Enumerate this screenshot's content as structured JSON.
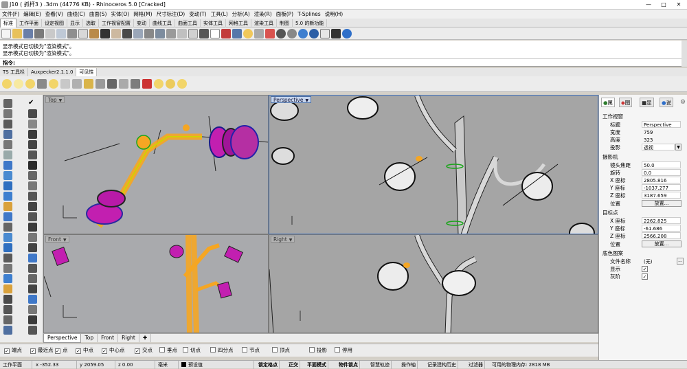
{
  "window": {
    "title": "J10 ( 抓杆3 ) .3dm (44776 KB) - Rhinoceros 5.0 [Cracked]",
    "minimize": "—",
    "maximize": "□",
    "close": "✕"
  },
  "menu": [
    "文件(F)",
    "编辑(E)",
    "查看(V)",
    "曲线(C)",
    "曲面(S)",
    "实体(O)",
    "网格(M)",
    "尺寸标注(D)",
    "变动(T)",
    "工具(L)",
    "分析(A)",
    "渲染(R)",
    "面板(P)",
    "T-Splines",
    "说明(H)"
  ],
  "toolbar_tabs": {
    "items": [
      "标准",
      "工作平面",
      "设定视图",
      "显示",
      "选取",
      "工作视窗配置",
      "变动",
      "曲线工具",
      "曲面工具",
      "实体工具",
      "网格工具",
      "渲染工具",
      "制图",
      "5.0 的新功能"
    ],
    "active": 0
  },
  "command": {
    "history": [
      "显示模式已切换为\"渲染模式\"。",
      "显示模式已切换为\"渲染模式\"。"
    ],
    "prompt": "指令:"
  },
  "toolbar2_tabs": {
    "items": [
      "TS 工具栏",
      "Auxpecker2.1.1.0",
      "可见性"
    ],
    "active": 2
  },
  "viewports": [
    {
      "label": "Top",
      "active": false
    },
    {
      "label": "Perspective",
      "active": true
    },
    {
      "label": "Front",
      "active": false
    },
    {
      "label": "Right",
      "active": false
    }
  ],
  "viewport_tabs": {
    "items": [
      "Perspective",
      "Top",
      "Front",
      "Right"
    ],
    "active": 0,
    "add": "✚"
  },
  "osnaps": [
    {
      "label": "端点",
      "checked": true
    },
    {
      "label": "最近点",
      "checked": true
    },
    {
      "label": "点",
      "checked": true
    },
    {
      "label": "中点",
      "checked": true
    },
    {
      "label": "中心点",
      "checked": true
    },
    {
      "label": "交点",
      "checked": true
    },
    {
      "label": "垂点",
      "checked": false
    },
    {
      "label": "切点",
      "checked": false
    },
    {
      "label": "四分点",
      "checked": false
    },
    {
      "label": "节点",
      "checked": false
    },
    {
      "label": "顶点",
      "checked": false
    },
    {
      "label": "投影",
      "checked": false
    },
    {
      "label": "停用",
      "checked": false
    }
  ],
  "status": {
    "cplane": "工作平面",
    "x": "x -352.33",
    "y": "y 2059.05",
    "z": "z 0.00",
    "unit": "毫米",
    "layer": "预设值",
    "items": [
      "锁定格点",
      "正交",
      "平面模式",
      "物件锁点",
      "智慧轨迹",
      "操作轴",
      "记录建构历史",
      "过滤器"
    ],
    "memory": "可用的物理内存: 2818 MB"
  },
  "panel": {
    "tabs": [
      "属",
      "图",
      "显",
      "说"
    ],
    "active_tab": 0,
    "section_viewport": "工作视窗",
    "vp_rows": [
      {
        "label": "标题",
        "value": "Perspective"
      },
      {
        "label": "宽度",
        "value": "759"
      },
      {
        "label": "高度",
        "value": "323"
      },
      {
        "label": "投影",
        "value": "透视"
      }
    ],
    "section_camera": "摄影机",
    "cam_rows": [
      {
        "label": "镜头焦距",
        "value": "50.0"
      },
      {
        "label": "旋转",
        "value": "0.0"
      },
      {
        "label": "X 座标",
        "value": "2805.816"
      },
      {
        "label": "Y 座标",
        "value": "-1037.277"
      },
      {
        "label": "Z 座标",
        "value": "3187.659"
      }
    ],
    "position_label": "位置",
    "place_button": "放置...",
    "section_target": "目标点",
    "tgt_rows": [
      {
        "label": "X 座标",
        "value": "2262.825"
      },
      {
        "label": "Y 座标",
        "value": "-61.686"
      },
      {
        "label": "Z 座标",
        "value": "2566.208"
      }
    ],
    "section_wallpaper": "底色图案",
    "file_label": "文件名称",
    "file_value": "(无)",
    "browse": "...",
    "show_label": "显示",
    "gray_label": "灰阶"
  },
  "colors": {
    "highlight": "#f5a623",
    "selection": "#c8d8f0",
    "accent_blue": "#3b6fbf"
  }
}
